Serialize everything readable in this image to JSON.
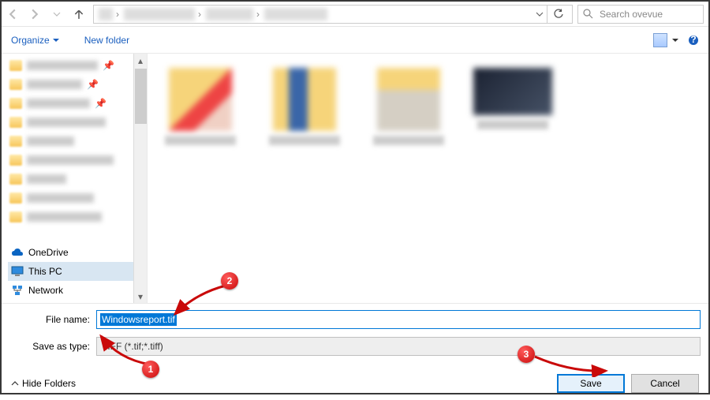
{
  "nav": {
    "search_placeholder": "Search ovevue"
  },
  "toolbar": {
    "organize": "Organize",
    "new_folder": "New folder"
  },
  "places": {
    "onedrive": "OneDrive",
    "thispc": "This PC",
    "network": "Network"
  },
  "form": {
    "filename_label": "File name:",
    "filename_value": "Windowsreport.tif",
    "type_label": "Save as type:",
    "type_value": "TIFF (*.tif;*.tiff)"
  },
  "footer": {
    "hide_folders": "Hide Folders",
    "save": "Save",
    "cancel": "Cancel"
  },
  "annotations": {
    "b1": "1",
    "b2": "2",
    "b3": "3"
  }
}
